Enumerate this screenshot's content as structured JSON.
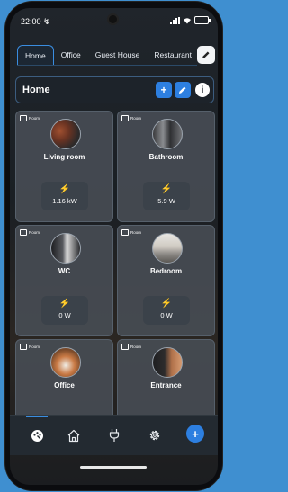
{
  "status": {
    "time": "22:00 ↯"
  },
  "tabs": [
    "Home",
    "Office",
    "Guest House",
    "Restaurant"
  ],
  "homebar": {
    "title": "Home"
  },
  "cards": [
    {
      "badge": "Room",
      "name": "Living room",
      "power": "1.16 kW"
    },
    {
      "badge": "Room",
      "name": "Bathroom",
      "power": "5.9 W"
    },
    {
      "badge": "Room",
      "name": "WC",
      "power": "0 W"
    },
    {
      "badge": "Room",
      "name": "Bedroom",
      "power": "0 W"
    },
    {
      "badge": "Room",
      "name": "Office",
      "power": ""
    },
    {
      "badge": "Room",
      "name": "Entrance",
      "power": ""
    }
  ],
  "icons": {
    "power": "bolt-icon",
    "tab_edit": "pencil-icon",
    "add": "plus-icon",
    "edit": "pencil-icon",
    "info": "info-icon",
    "nav": [
      "dashboard-icon",
      "home-icon",
      "plug-icon",
      "gear-icon",
      "plus-icon"
    ]
  },
  "colors": {
    "accent": "#2d7fe0",
    "background": "#3f8fd0",
    "card": "#464c54"
  }
}
